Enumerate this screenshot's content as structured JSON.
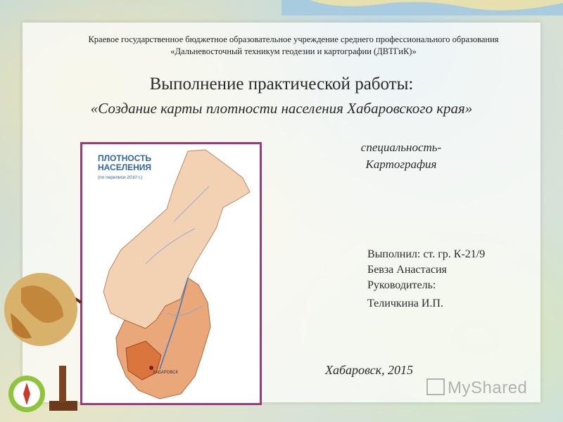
{
  "header": {
    "org_line1": "Краевое государственное бюджетное образовательное учреждение среднего профессионального образования",
    "org_line2": "«Дальневосточный техникум геодезии и картографии (ДВТГиК)»"
  },
  "title": "Выполнение практической работы:",
  "subtitle": "«Создание карты плотности населения Хабаровского края»",
  "specialty": {
    "label": "специальность-",
    "value": "Картография"
  },
  "authors": {
    "performer": "Выполнил: ст. гр. К-21/9",
    "performer_name": "Бевза Анастасия",
    "supervisor": "Руководитель:",
    "supervisor_name": "Теличкина И.П."
  },
  "city_year": "Хабаровск, 2015",
  "map": {
    "title_line1": "ПЛОТНОСТЬ",
    "title_line2": "НАСЕЛЕНИЯ",
    "note": "(по переписи 2010 г.)",
    "city_label": "ХАБАРОВСК"
  },
  "watermark": "MyShared",
  "colors": {
    "frame": "#9b3a7c",
    "map_title": "#2f66a8",
    "region_light": "#f3d2b4",
    "region_mid": "#e9a77a",
    "region_dark": "#d9753d"
  }
}
